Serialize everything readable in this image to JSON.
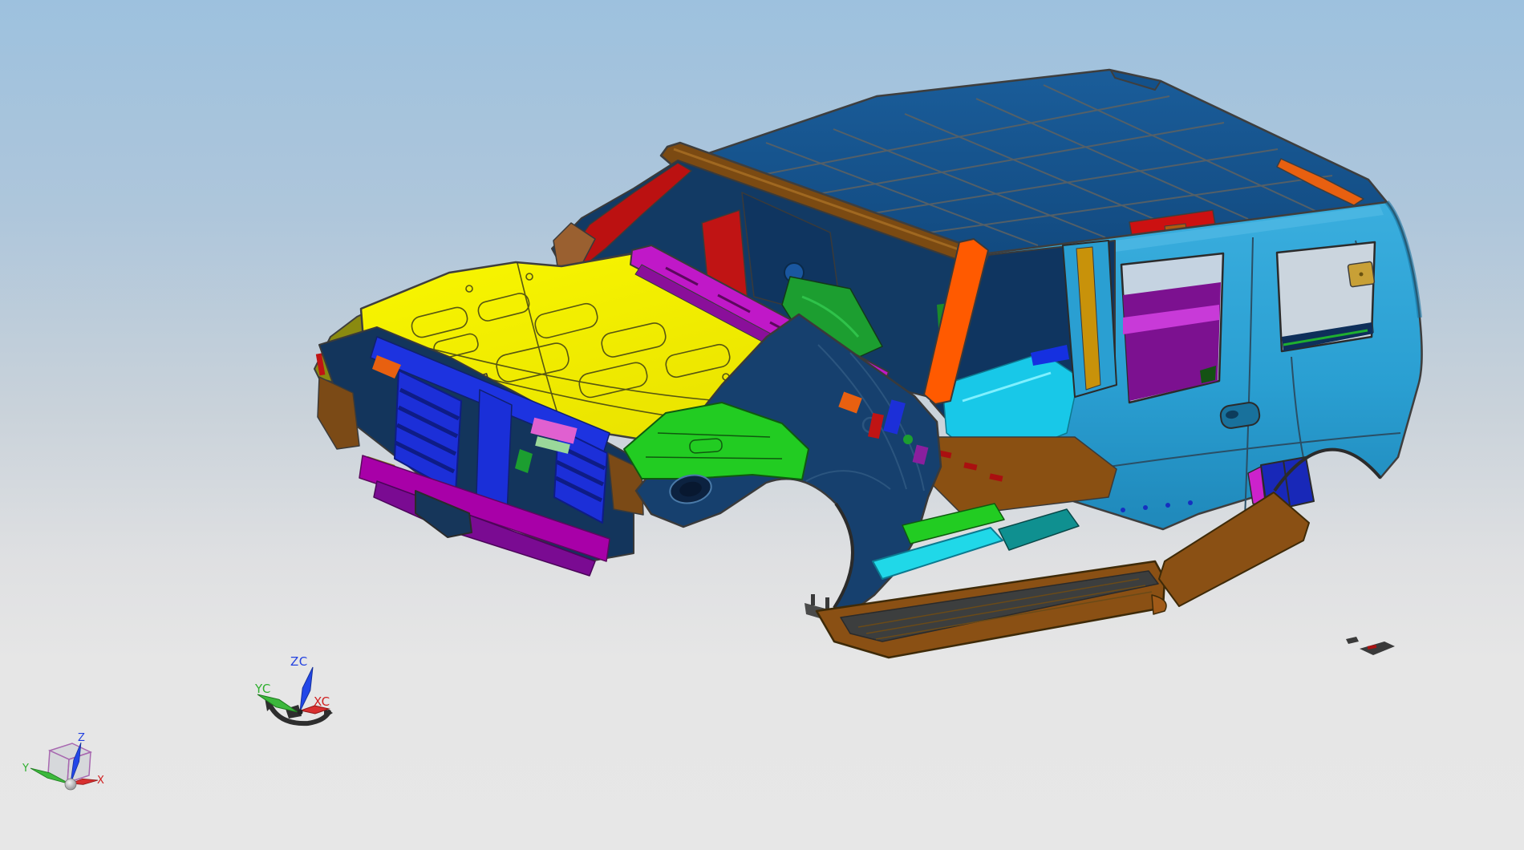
{
  "viewport": {
    "type": "3d-cad-graphics-window",
    "background_top_color": "#9dc1de",
    "background_bottom_color": "#e7e7e7"
  },
  "model": {
    "description": "SUV body-in-white assembly, multi-colored sheet-metal parts, isometric view",
    "parts": [
      {
        "name": "roof-panel",
        "color": "#15568f"
      },
      {
        "name": "windshield-header-rail",
        "color": "#7b4a12"
      },
      {
        "name": "hood-panel",
        "color": "#f6f300"
      },
      {
        "name": "left-fender-apron",
        "color": "#8a8a10"
      },
      {
        "name": "cowl-vent-strip",
        "color": "#c018c8"
      },
      {
        "name": "a-pillar-far",
        "color": "#bb1111"
      },
      {
        "name": "a-pillar-near",
        "color": "#ff5a00"
      },
      {
        "name": "front-fender",
        "color": "#16406e"
      },
      {
        "name": "grille-radiator-frame",
        "color": "#1c2fd8"
      },
      {
        "name": "front-bumper-beam",
        "color": "#a800a8"
      },
      {
        "name": "front-floor-pan",
        "color": "#22cc22"
      },
      {
        "name": "rocker-sill-inner",
        "color": "#20d8e8"
      },
      {
        "name": "running-board",
        "color": "#8a5014"
      },
      {
        "name": "side-body-quarter-panel",
        "color": "#2a9fd2"
      },
      {
        "name": "interior-quarter-trim",
        "color": "#7c1190"
      },
      {
        "name": "b-pillar-reinforcement",
        "color": "#c8920a"
      },
      {
        "name": "dash-structure",
        "color": "#10365f"
      }
    ]
  },
  "wcs_triad": {
    "z_label": "ZC",
    "y_label": "YC",
    "x_label": "XC",
    "z_color": "#2442e0",
    "y_color": "#2faf2f",
    "x_color": "#d02020"
  },
  "view_gnomon": {
    "z_label": "Z",
    "y_label": "Y",
    "x_label": "X",
    "z_color": "#2442e0",
    "y_color": "#2faf2f",
    "x_color": "#d02020"
  }
}
